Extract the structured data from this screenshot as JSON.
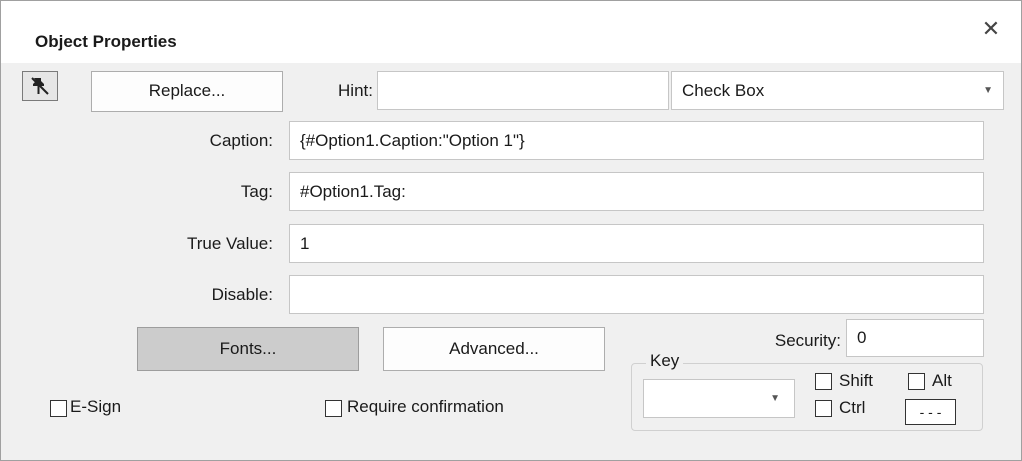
{
  "dialog": {
    "title": "Object Properties",
    "close_glyph": "✕"
  },
  "toolbar": {
    "pin_icon": "pin-icon",
    "replace_label": "Replace...",
    "hint_label": "Hint:",
    "hint_value": "",
    "type_value": "Check Box"
  },
  "fields": {
    "caption_label": "Caption:",
    "caption_value": "{#Option1.Caption:\"Option 1\"}",
    "tag_label": "Tag:",
    "tag_value": "#Option1.Tag:",
    "true_value_label": "True Value:",
    "true_value_value": "1",
    "disable_label": "Disable:",
    "disable_value": ""
  },
  "buttons": {
    "fonts_label": "Fonts...",
    "advanced_label": "Advanced..."
  },
  "security": {
    "label": "Security:",
    "value": "0"
  },
  "key": {
    "legend": "Key",
    "combo_value": "",
    "shift_label": "Shift",
    "alt_label": "Alt",
    "ctrl_label": "Ctrl",
    "ellipsis_label": "- - -"
  },
  "checks": {
    "esign_label": "E-Sign",
    "require_confirmation_label": "Require confirmation"
  }
}
